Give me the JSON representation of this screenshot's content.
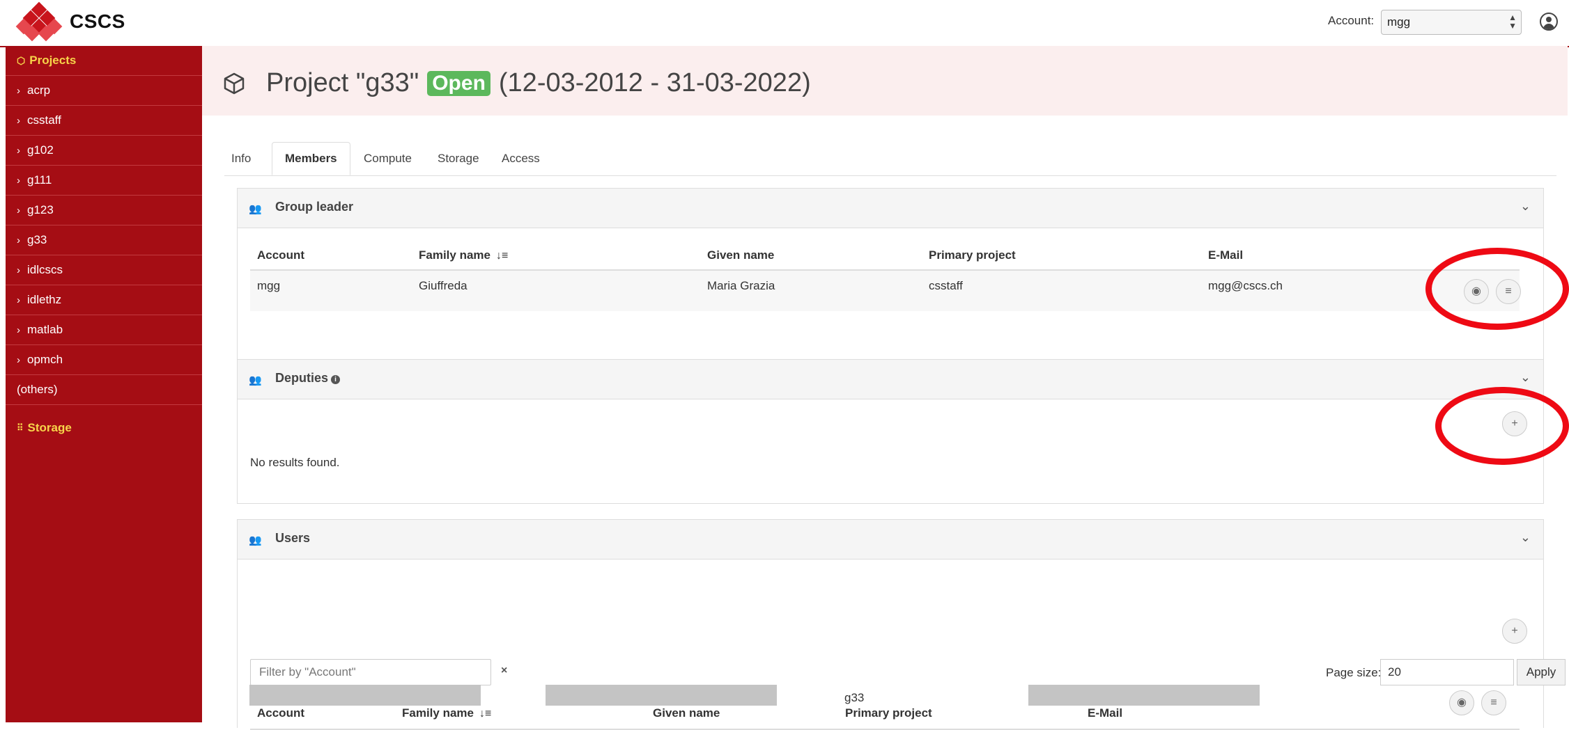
{
  "app": {
    "logo_text": "CSCS"
  },
  "header": {
    "account_label": "Account:",
    "account_value": "mgg"
  },
  "sidebar": {
    "projects_label": "Projects",
    "items": [
      {
        "label": "acrp"
      },
      {
        "label": "csstaff"
      },
      {
        "label": "g102"
      },
      {
        "label": "g111"
      },
      {
        "label": "g123"
      },
      {
        "label": "g33"
      },
      {
        "label": "idlcscs"
      },
      {
        "label": "idlethz"
      },
      {
        "label": "matlab"
      },
      {
        "label": "opmch"
      }
    ],
    "others_label": "(others)",
    "storage_label": "Storage"
  },
  "project": {
    "title_prefix": "Project \"g33\"",
    "status": "Open",
    "dates": "(12-03-2012 - 31-03-2022)"
  },
  "tabs": [
    {
      "label": "Info"
    },
    {
      "label": "Members"
    },
    {
      "label": "Compute"
    },
    {
      "label": "Storage"
    },
    {
      "label": "Access"
    }
  ],
  "group_leader": {
    "title": "Group leader",
    "columns": [
      "Account",
      "Family name",
      "Given name",
      "Primary project",
      "E-Mail"
    ],
    "rows": [
      {
        "account": "mgg",
        "family": "Giuffreda",
        "given": "Maria Grazia",
        "primary": "csstaff",
        "email": "mgg@cscs.ch"
      }
    ]
  },
  "deputies": {
    "title": "Deputies",
    "empty_text": "No results found."
  },
  "users": {
    "title": "Users",
    "filter_placeholder": "Filter by \"Account\"",
    "clear_label": "×",
    "page_size_label": "Page size:",
    "page_size_value": "20",
    "apply_label": "Apply",
    "columns": [
      "Account",
      "Family name",
      "Given name",
      "Primary project",
      "E-Mail"
    ],
    "rows": [
      {
        "primary": "g33"
      }
    ]
  },
  "icons": {
    "view": "eye-icon",
    "menu": "list-icon",
    "add": "plus-icon",
    "group": "users-icon",
    "caret": "chevron-down-icon"
  },
  "colors": {
    "brand_red": "#a50d14",
    "open_badge": "#5cb85c",
    "annotation_red": "#ee0a14",
    "sidebar_highlight": "#f7d44a"
  }
}
